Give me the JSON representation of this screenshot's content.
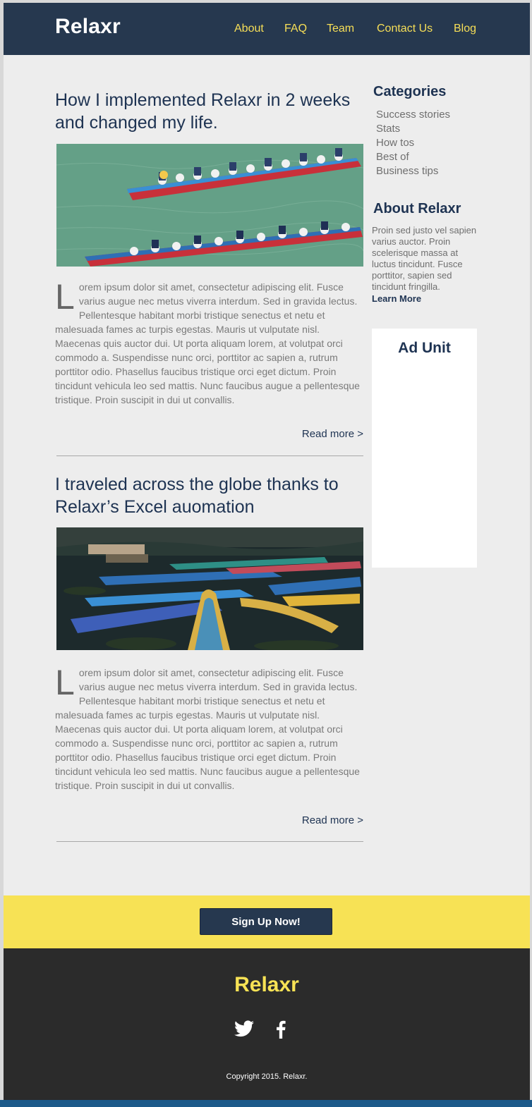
{
  "header": {
    "logo": "Relaxr",
    "nav": [
      "About",
      "FAQ",
      "Team",
      "Contact Us",
      "Blog"
    ]
  },
  "posts": [
    {
      "title": "How I implemented Relaxr in 2 weeks and changed my life.",
      "image": "dragon-boat-race-photo",
      "dropcap": "L",
      "body": "orem ipsum dolor sit amet, consectetur adipiscing elit. Fusce varius augue nec metus viverra interdum. Sed in gravida lectus. Pellentesque habitant morbi tristique senectus et netu et malesuada fames ac turpis egestas. Mauris ut vulputate nisl. Maecenas quis auctor dui. Ut porta aliquam lorem, at volutpat orci commodo a. Suspendisse nunc orci, porttitor ac sapien a, rutrum porttitor odio. Phasellus faucibus tristique orci eget dictum. Proin tincidunt vehicula leo sed mattis. Nunc faucibus augue a pellentesque tristique. Proin suscipit in dui ut convallis.",
      "read_more": "Read more >"
    },
    {
      "title": "I traveled across the globe thanks to Relaxr’s Excel auomation",
      "image": "lake-rowboats-photo",
      "dropcap": "L",
      "body": "orem ipsum dolor sit amet, consectetur adipiscing elit. Fusce varius augue nec metus viverra interdum. Sed in gravida lectus. Pellentesque habitant morbi tristique senectus et netu et malesuada fames ac turpis egestas. Mauris ut vulputate nisl. Maecenas quis auctor dui. Ut porta aliquam lorem, at volutpat orci commodo a. Suspendisse nunc orci, porttitor ac sapien a, rutrum porttitor odio. Phasellus faucibus tristique orci eget dictum. Proin tincidunt vehicula leo sed mattis. Nunc faucibus augue a pellentesque tristique. Proin suscipit in dui ut convallis.",
      "read_more": "Read more >"
    }
  ],
  "sidebar": {
    "categories_heading": "Categories",
    "categories": [
      "Success stories",
      "Stats",
      "How tos",
      "Best of",
      "Business tips"
    ],
    "about_heading": "About Relaxr",
    "about_text": "Proin sed justo vel sapien varius auctor. Proin scelerisque massa at luctus tincidunt. Fusce porttitor, sapien sed tincidunt fringilla.",
    "learn_more": "Learn More",
    "ad_label": "Ad Unit"
  },
  "signup": {
    "button": "Sign Up Now!"
  },
  "footer": {
    "logo": "Relaxr",
    "social": [
      "twitter-icon",
      "facebook-icon"
    ],
    "copyright": "Copyright 2015. Relaxr."
  },
  "colors": {
    "header_bg": "#26384f",
    "nav_link": "#f7df57",
    "heading": "#1e3352",
    "signup_band": "#f7e255",
    "footer_bg": "#2b2b2b",
    "footer_logo": "#f7e255"
  }
}
